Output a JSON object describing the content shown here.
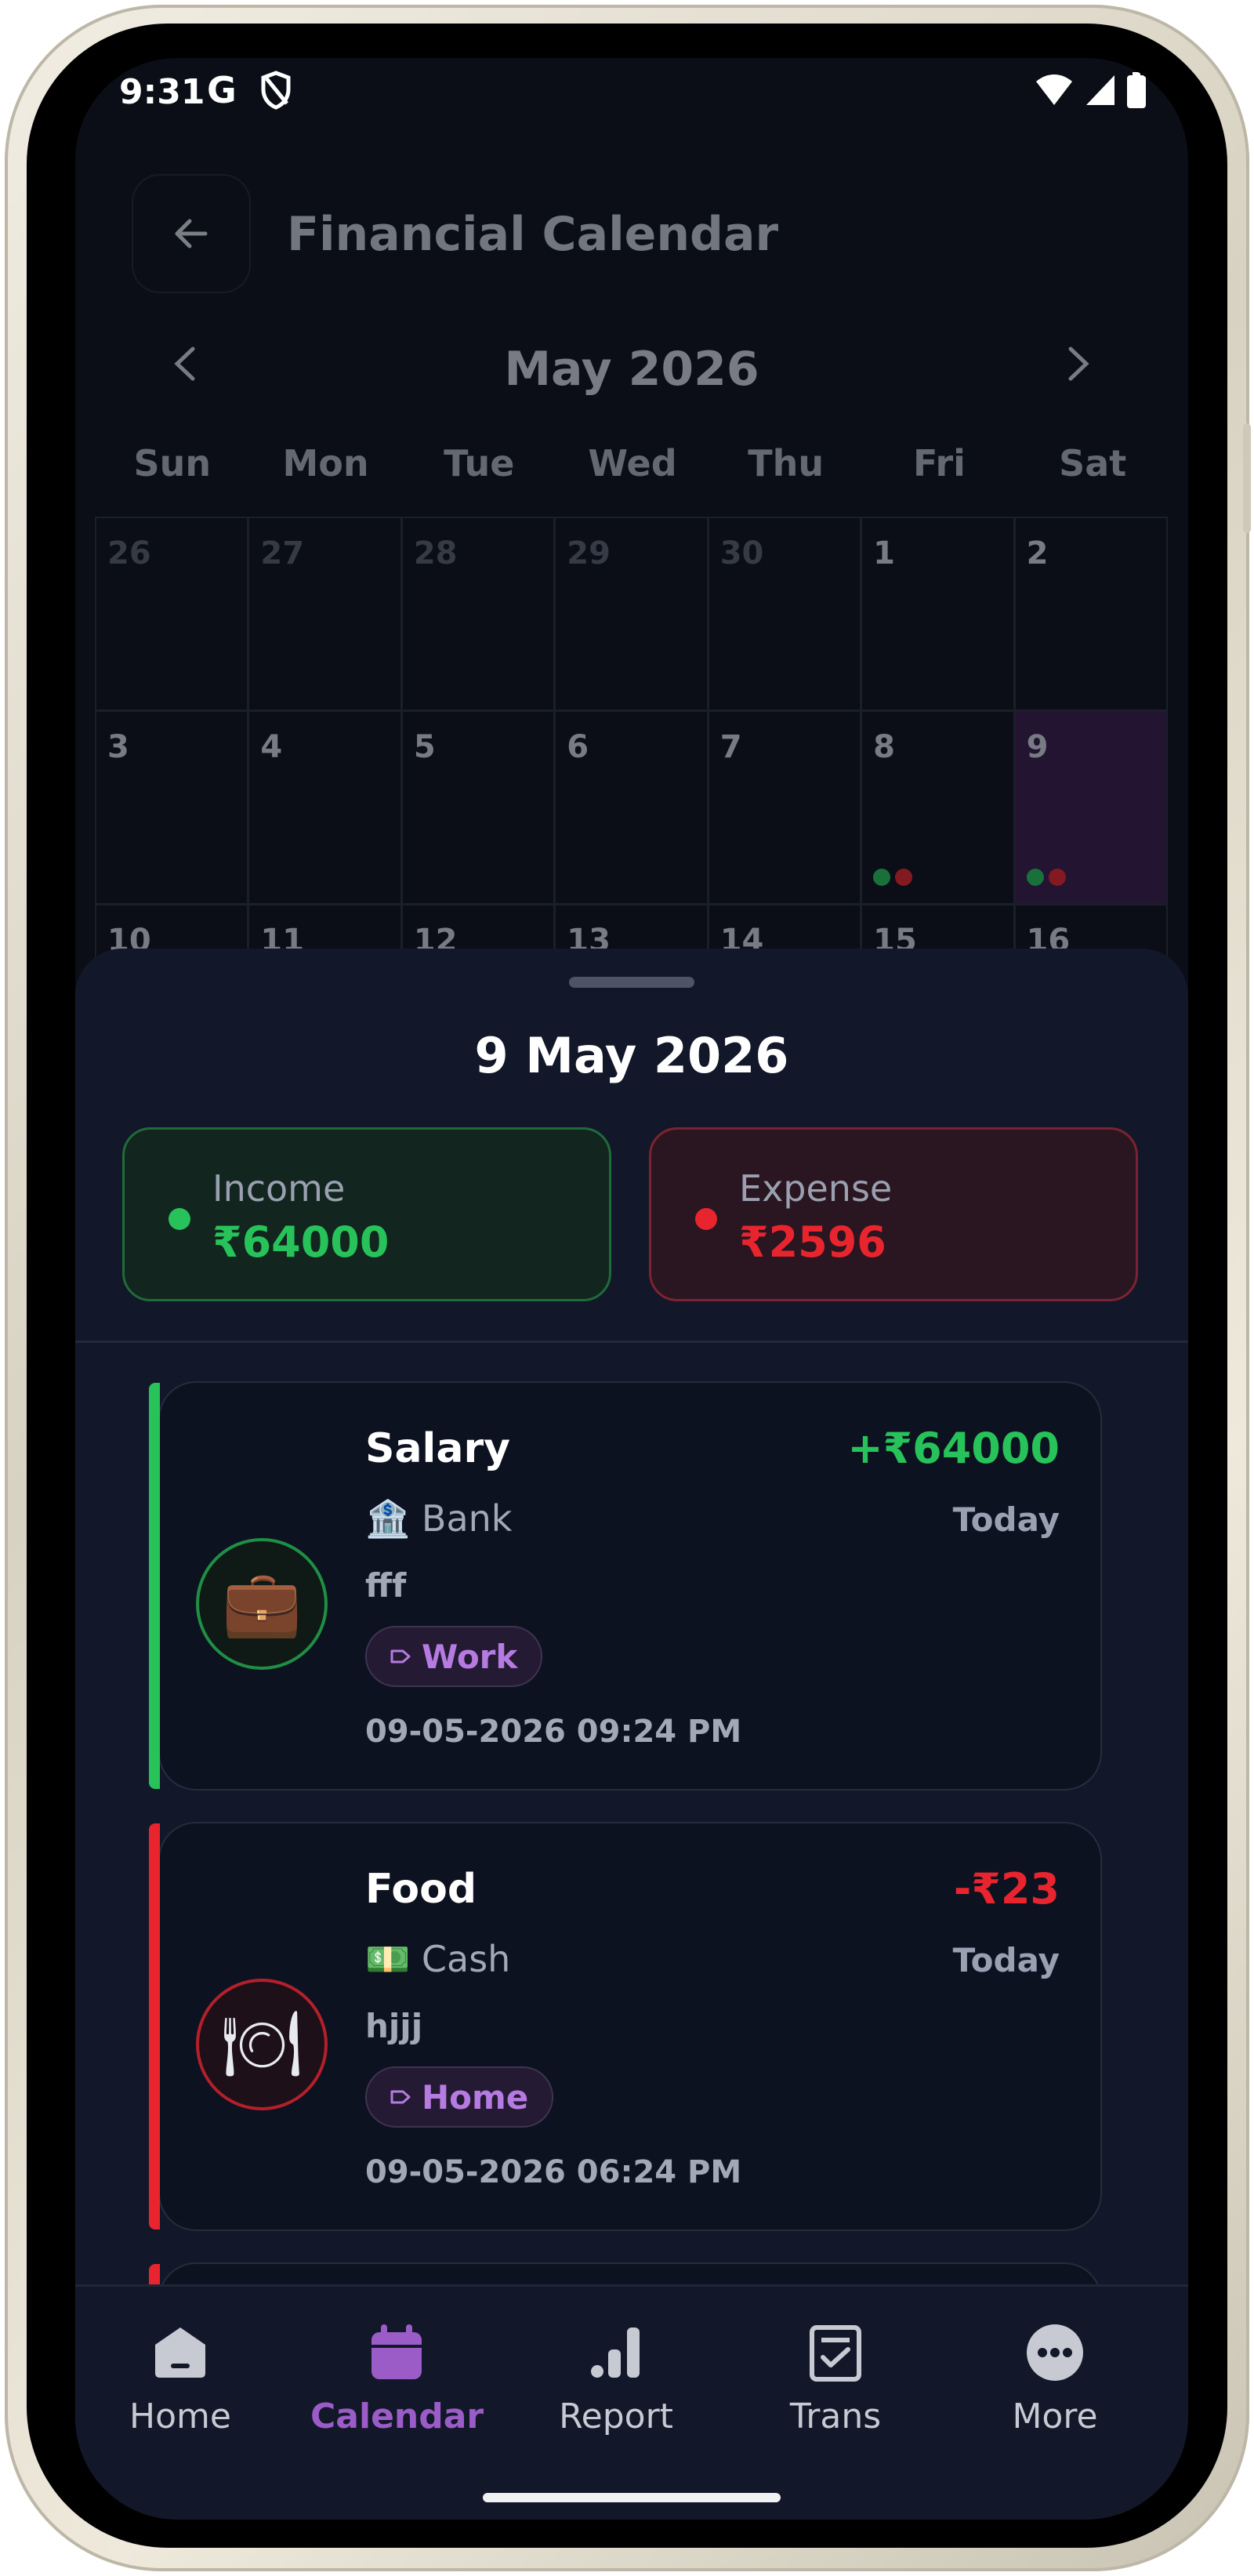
{
  "status": {
    "time": "9:31",
    "carrier_glyph": "G"
  },
  "header": {
    "title": "Financial Calendar"
  },
  "calendar": {
    "month_label": "May 2026",
    "weekdays": [
      "Sun",
      "Mon",
      "Tue",
      "Wed",
      "Thu",
      "Fri",
      "Sat"
    ],
    "rows": [
      [
        "26",
        "27",
        "28",
        "29",
        "30",
        "1",
        "2"
      ],
      [
        "3",
        "4",
        "5",
        "6",
        "7",
        "8",
        "9"
      ],
      [
        "10",
        "11",
        "12",
        "13",
        "14",
        "15",
        "16"
      ]
    ],
    "selected_day": "9"
  },
  "sheet": {
    "date": "9 May 2026",
    "income": {
      "label": "Income",
      "value": "₹64000"
    },
    "expense": {
      "label": "Expense",
      "value": "₹2596"
    },
    "transactions": [
      {
        "title": "Salary",
        "amount": "+₹64000",
        "account_emoji": "🏦",
        "account": "Bank",
        "when": "Today",
        "note": "fff",
        "tag": "Work",
        "datetime": "09-05-2026  09:24 PM",
        "icon": "briefcase-icon",
        "icon_glyph": "💼"
      },
      {
        "title": "Food",
        "amount": "-₹23",
        "account_emoji": "💵",
        "account": "Cash",
        "when": "Today",
        "note": "hjjj",
        "tag": "Home",
        "datetime": "09-05-2026  06:24 PM",
        "icon": "plate-icon",
        "icon_glyph": "🍽"
      }
    ]
  },
  "nav": {
    "items": [
      {
        "label": "Home",
        "icon": "home-icon"
      },
      {
        "label": "Calendar",
        "icon": "calendar-icon"
      },
      {
        "label": "Report",
        "icon": "bar-chart-icon"
      },
      {
        "label": "Trans",
        "icon": "transactions-icon"
      },
      {
        "label": "More",
        "icon": "more-icon"
      }
    ],
    "active": "Calendar"
  },
  "colors": {
    "income": "#27c25a",
    "expense": "#e8252f",
    "accent": "#9b5cc8",
    "background": "#0b0e16",
    "sheet": "#121829"
  }
}
